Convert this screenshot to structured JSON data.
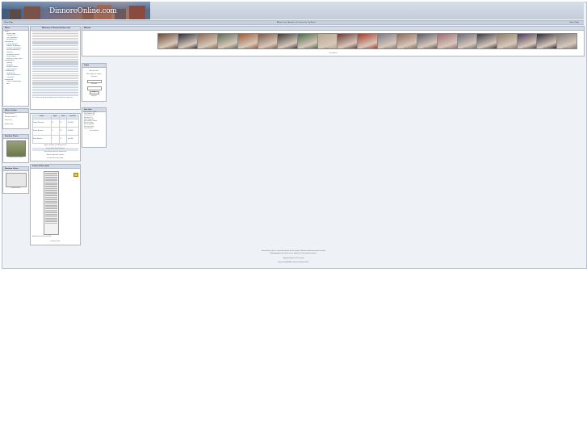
{
  "site": {
    "logo_text": "DinnoreOnline.com",
    "nav_left": "Home Page",
    "nav_center": "Albums   Last Uploads   Last Comments   Top Rated",
    "nav_right": "Login  |  Help"
  },
  "menu": {
    "title": "Menu",
    "sections": [
      {
        "label": "Main",
        "items": [
          "Home Page",
          "Contact Us",
          "Site Statistics",
          "Recommend"
        ]
      },
      {
        "label": "Interactive",
        "items": [
          "Photo Albums",
          "Submit an Album",
          "Dinnore Memories",
          "Recent Additions",
          "Forums",
          "Scanned Letters",
          "Guest Book",
          "Links to Other Sites"
        ]
      },
      {
        "label": "Information",
        "items": [
          "History",
          "Dinnore",
          "People Search",
          "Local Events"
        ]
      },
      {
        "label": "Community",
        "items": [
          "Newsletter",
          "Local Businesses",
          "Churches"
        ]
      },
      {
        "label": "Resources",
        "items": [
          "Useful Downloads",
          "FAQ"
        ]
      }
    ]
  },
  "who_online": {
    "title": "Who's Online",
    "lines": [
      "Guests online: 3",
      "Members online: 0",
      "Total visits",
      "Register now"
    ]
  },
  "random_photo": {
    "title": "Random Photo",
    "caption": "Random photo caption"
  },
  "random_letter": {
    "title": "Random Letter",
    "caption": "Scanned letter"
  },
  "welcome": {
    "title": "Welcome to DinnoreOnline.com",
    "footer": "If you have any questions please do not hesitate to contact us."
  },
  "forum": {
    "columns": [
      "Forum",
      "Topics",
      "Posts",
      "Last Post"
    ],
    "rows": [
      {
        "name": "General Discussion",
        "topics": "12",
        "posts": "47",
        "last": "Mar 2008"
      },
      {
        "name": "Dinnore Memories",
        "topics": "9",
        "posts": "31",
        "last": "Feb 2008"
      },
      {
        "name": "Family Research",
        "topics": "7",
        "posts": "22",
        "last": "Jan 2008"
      }
    ],
    "summary": "Topics: 28  Posts: 100  Members: 35",
    "links": "Forum Index   Search Forums",
    "blurb": [
      "Latest forum posts are shown here",
      "Newest registered member",
      "Join the discussion today"
    ]
  },
  "letters": {
    "title": "Letter of the week",
    "caption": "Handwritten letter from 1918",
    "nav": "Previous  |  Next"
  },
  "albums": {
    "title": "Albums",
    "more": "more photos",
    "captions": [
      "Photo 1",
      "Photo 2",
      "Photo 3",
      "Photo 4",
      "Photo 5",
      "Photo 6",
      "Photo 7",
      "Photo 8",
      "Photo 9",
      "Photo 10",
      "Photo 11",
      "Photo 12",
      "Photo 13",
      "Photo 14",
      "Photo 15",
      "Photo 16",
      "Photo 17",
      "Photo 18",
      "Photo 19",
      "Photo 20",
      "Photo 21"
    ],
    "colors": [
      "#6a4a3a",
      "#2c2c3a",
      "#8a6a55",
      "#5c6a5a",
      "#9a5a3a",
      "#7a5a4a",
      "#3a3a3a",
      "#4a6a4a",
      "#b5a890",
      "#6a3a3a",
      "#a8382c",
      "#7a7a8a",
      "#8a6a5a",
      "#5a5a6a",
      "#9a6a7a",
      "#6a6a7a",
      "#3a3a4a",
      "#8a7a6a",
      "#4a3a5a",
      "#2a2a3a",
      "#7a7a7a"
    ]
  },
  "login": {
    "title": "Login",
    "welcome": "Welcome back",
    "note": "Please log in or register",
    "username_label": "Username",
    "password_label": "Password",
    "button": "Login",
    "register": "Register"
  },
  "stats": {
    "title": "Site Info",
    "lines": [
      "Total photos: 1,240",
      "Total albums: 58",
      "Comments: 312",
      "Members: 35",
      "Visits today: 87",
      "Most popular album",
      "Newest album",
      "Recent uploads",
      "Top rated photo",
      "Last comment"
    ],
    "more": "view statistics"
  },
  "footer": {
    "lines": [
      "DinnoreOnline.com is a community website for the people of Dinnore and friends around the world.",
      "All photographs and content are the property of their respective owners.",
      "Page generated in 0.12 seconds",
      "Powered by PHP-Nuke   Theme by DinnoreOnline"
    ]
  }
}
